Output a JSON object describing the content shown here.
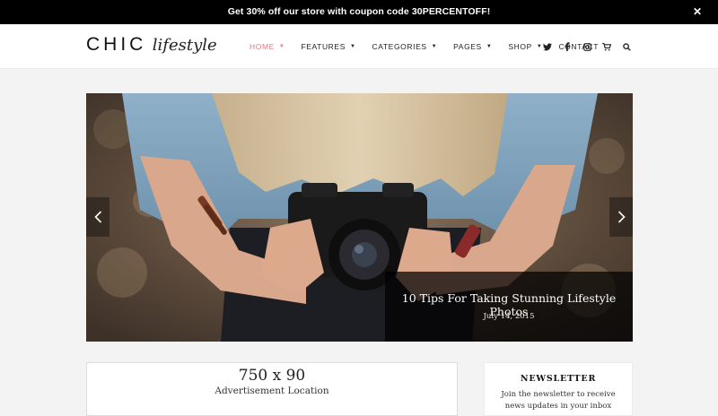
{
  "promo": {
    "text": "Get 30% off our store with coupon code 30PERCENTOFF!",
    "close_icon": "close-icon",
    "close_glyph": "✕"
  },
  "header": {
    "logo_main": "CHIC",
    "logo_sub": "lifestyle",
    "nav": [
      {
        "label": "HOME",
        "active": true
      },
      {
        "label": "FEATURES"
      },
      {
        "label": "CATEGORIES"
      },
      {
        "label": "PAGES"
      },
      {
        "label": "SHOP"
      },
      {
        "label": "CONTACT"
      }
    ],
    "icons": [
      "twitter-icon",
      "facebook-icon",
      "instagram-icon",
      "cart-icon",
      "search-icon"
    ],
    "active_color": "#e67a86"
  },
  "slider": {
    "title": "10 Tips For Taking Stunning Lifestyle Photos",
    "date": "July 14, 2015",
    "prev_icon": "chevron-left-icon",
    "next_icon": "chevron-right-icon"
  },
  "ad": {
    "size": "750 x 90",
    "label": "Advertisement Location"
  },
  "newsletter": {
    "title": "NEWSLETTER",
    "text": "Join the newsletter to receive news updates in your inbox"
  }
}
